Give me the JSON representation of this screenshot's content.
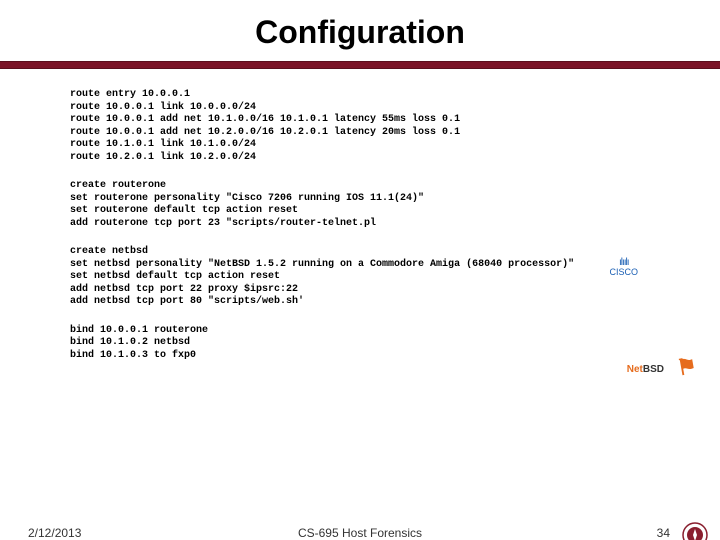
{
  "title": "Configuration",
  "blocks": {
    "routes": "route entry 10.0.0.1\nroute 10.0.0.1 link 10.0.0.0/24\nroute 10.0.0.1 add net 10.1.0.0/16 10.1.0.1 latency 55ms loss 0.1\nroute 10.0.0.1 add net 10.2.0.0/16 10.2.0.1 latency 20ms loss 0.1\nroute 10.1.0.1 link 10.1.0.0/24\nroute 10.2.0.1 link 10.2.0.0/24",
    "routerone": "create routerone\nset routerone personality \"Cisco 7206 running IOS 11.1(24)\"\nset routerone default tcp action reset\nadd routerone tcp port 23 \"scripts/router-telnet.pl",
    "netbsd": "create netbsd\nset netbsd personality \"NetBSD 1.5.2 running on a Commodore Amiga (68040 processor)\"\nset netbsd default tcp action reset\nadd netbsd tcp port 22 proxy $ipsrc:22\nadd netbsd tcp port 80 \"scripts/web.sh'",
    "binds": "bind 10.0.0.1 routerone\nbind 10.1.0.2 netbsd\nbind 10.1.0.3 to fxp0"
  },
  "logos": {
    "cisco_bars": "ılıılı",
    "cisco_text": "CISCO",
    "netbsd_net": "Net",
    "netbsd_bsd": "BSD",
    "netbsd_flag": "⚑"
  },
  "footer": {
    "date": "2/12/2013",
    "center": "CS-695 Host Forensics",
    "page": "34"
  }
}
